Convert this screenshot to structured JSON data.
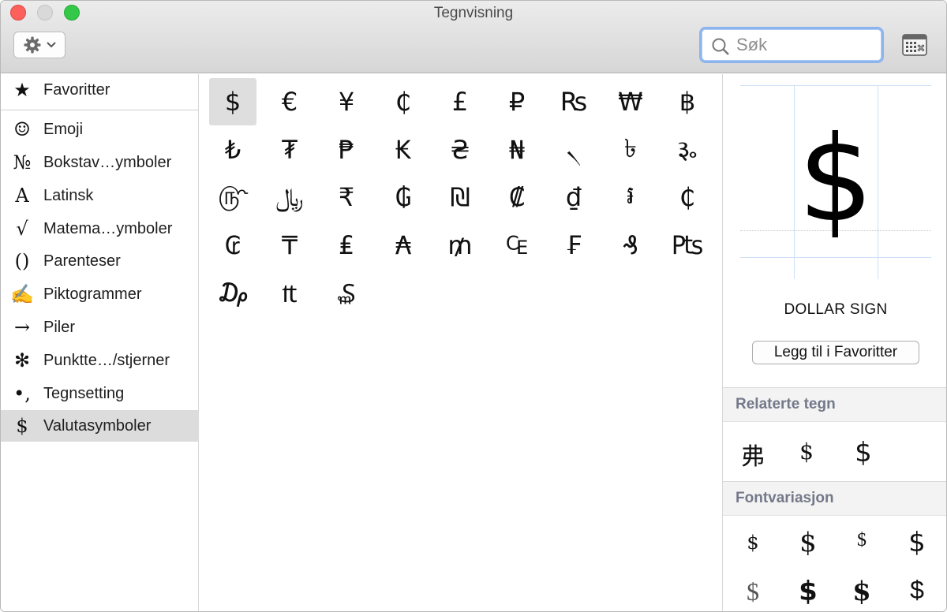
{
  "window": {
    "title": "Tegnvisning"
  },
  "toolbar": {
    "action_icon": "gear-icon",
    "search_placeholder": "Søk",
    "keyboard_icon": "keyboard-viewer-icon"
  },
  "sidebar": {
    "items": [
      {
        "icon": "★",
        "label": "Favoritter"
      },
      {
        "icon": "☺",
        "label": "Emoji"
      },
      {
        "icon": "№",
        "label": "Bokstav…ymboler"
      },
      {
        "icon": "A",
        "label": "Latinsk"
      },
      {
        "icon": "√",
        "label": "Matema…ymboler"
      },
      {
        "icon": "()",
        "label": "Parenteser"
      },
      {
        "icon": "✍",
        "label": "Piktogrammer"
      },
      {
        "icon": "→",
        "label": "Piler"
      },
      {
        "icon": "✻",
        "label": "Punktte…/stjerner"
      },
      {
        "icon": "•,",
        "label": "Tegnsetting"
      },
      {
        "icon": "$",
        "label": "Valutasymboler"
      }
    ],
    "selected": "Valutasymboler"
  },
  "grid": {
    "chars": [
      "$",
      "€",
      "¥",
      "₵",
      "£",
      "₽",
      "₨",
      "₩",
      "฿",
      "₺",
      "₮",
      "₱",
      "₭",
      "₴",
      "₦",
      "৲",
      "৳",
      "૱",
      "௹",
      "﷼",
      "₹",
      "₲",
      "₪",
      "₡",
      "₫",
      "៛",
      "₵",
      "₢",
      "₸",
      "₤",
      "₳",
      "₥",
      "₠",
      "₣",
      "₰",
      "₧",
      "₯",
      "₶",
      "₷"
    ],
    "selected_index": 0
  },
  "detail": {
    "preview_char": "$",
    "char_name": "DOLLAR SIGN",
    "add_favorite_label": "Legg til i Favoritter",
    "related_header": "Relaterte tegn",
    "related": [
      "弗",
      "$",
      "$"
    ],
    "font_variation_header": "Fontvariasjon",
    "font_variations": [
      "$",
      "$",
      "$",
      "$",
      "$",
      "$",
      "$",
      "$"
    ]
  }
}
